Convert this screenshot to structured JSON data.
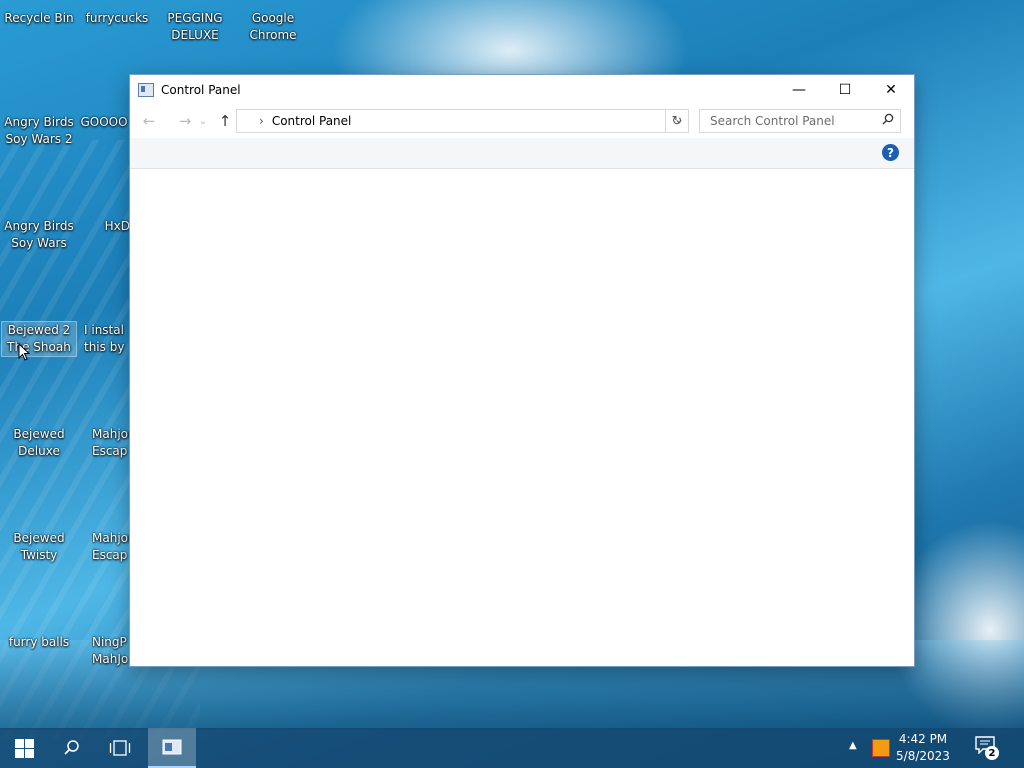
{
  "desktop": {
    "icons": [
      {
        "label": "Recycle Bin"
      },
      {
        "label": "furrycucks"
      },
      {
        "label": "PEGGING DELUXE"
      },
      {
        "label": "Google Chrome"
      },
      {
        "label": "Angry Birds Soy Wars 2"
      },
      {
        "label": "GOOOO"
      },
      {
        "label": "Angry Birds Soy Wars"
      },
      {
        "label": "HxD"
      },
      {
        "label": "Bejewed 2 The Shoah"
      },
      {
        "label": "I instal this by"
      },
      {
        "label": "Bejewed Deluxe"
      },
      {
        "label": "Mahjor Escap"
      },
      {
        "label": "Bejewed Twisty"
      },
      {
        "label": "Mahjor Escap"
      },
      {
        "label": "furry balls"
      },
      {
        "label": "NingP MahJo"
      }
    ]
  },
  "window": {
    "title": "Control Panel",
    "controls": {
      "minimize": "—",
      "maximize": "☐",
      "close": "✕"
    },
    "nav": {
      "back": "←",
      "forward": "→",
      "recent": "⌄",
      "up": "↑"
    },
    "address": {
      "chevron": "›",
      "crumb": "Control Panel",
      "dropdown": "⌄",
      "refresh": "↻"
    },
    "search": {
      "placeholder": "Search Control Panel",
      "icon": "search-icon"
    },
    "help": "?"
  },
  "taskbar": {
    "clock_time": "4:42 PM",
    "clock_date": "5/8/2023",
    "tray_arrow": "▲",
    "notification_count": "2"
  }
}
